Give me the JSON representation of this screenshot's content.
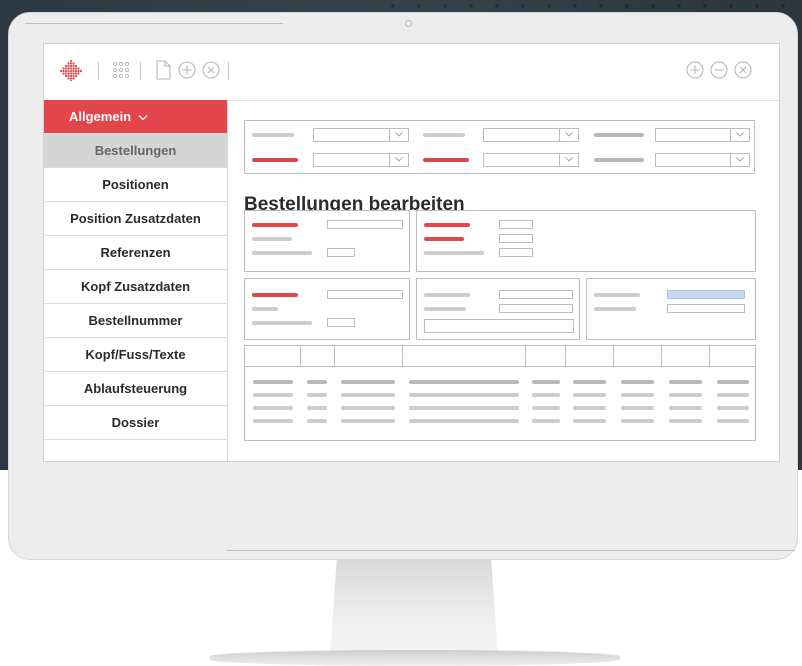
{
  "app": {
    "page_title": "Bestellungen bearbeiten"
  },
  "sidebar": {
    "items": [
      {
        "label": "Allgemein"
      },
      {
        "label": "Bestellungen"
      },
      {
        "label": "Positionen"
      },
      {
        "label": "Position Zusatzdaten"
      },
      {
        "label": "Referenzen"
      },
      {
        "label": "Kopf Zusatzdaten"
      },
      {
        "label": "Bestellnummer"
      },
      {
        "label": "Kopf/Fuss/Texte"
      },
      {
        "label": "Ablaufsteuerung"
      },
      {
        "label": "Dossier"
      }
    ]
  },
  "toolbar": {
    "left_icons": [
      "logo-icon",
      "grid-apps-icon",
      "new-document-icon",
      "add-circle-icon",
      "close-circle-icon"
    ],
    "right_icons": [
      "add-circle-icon",
      "minus-circle-icon",
      "close-circle-icon"
    ]
  },
  "colors": {
    "accent": "#e2454b",
    "selected_bg": "#d5d5d5",
    "highlight_field": "#c9d9ee",
    "placeholder_bar": "#cccccc",
    "background_dark": "#2f3c45"
  }
}
